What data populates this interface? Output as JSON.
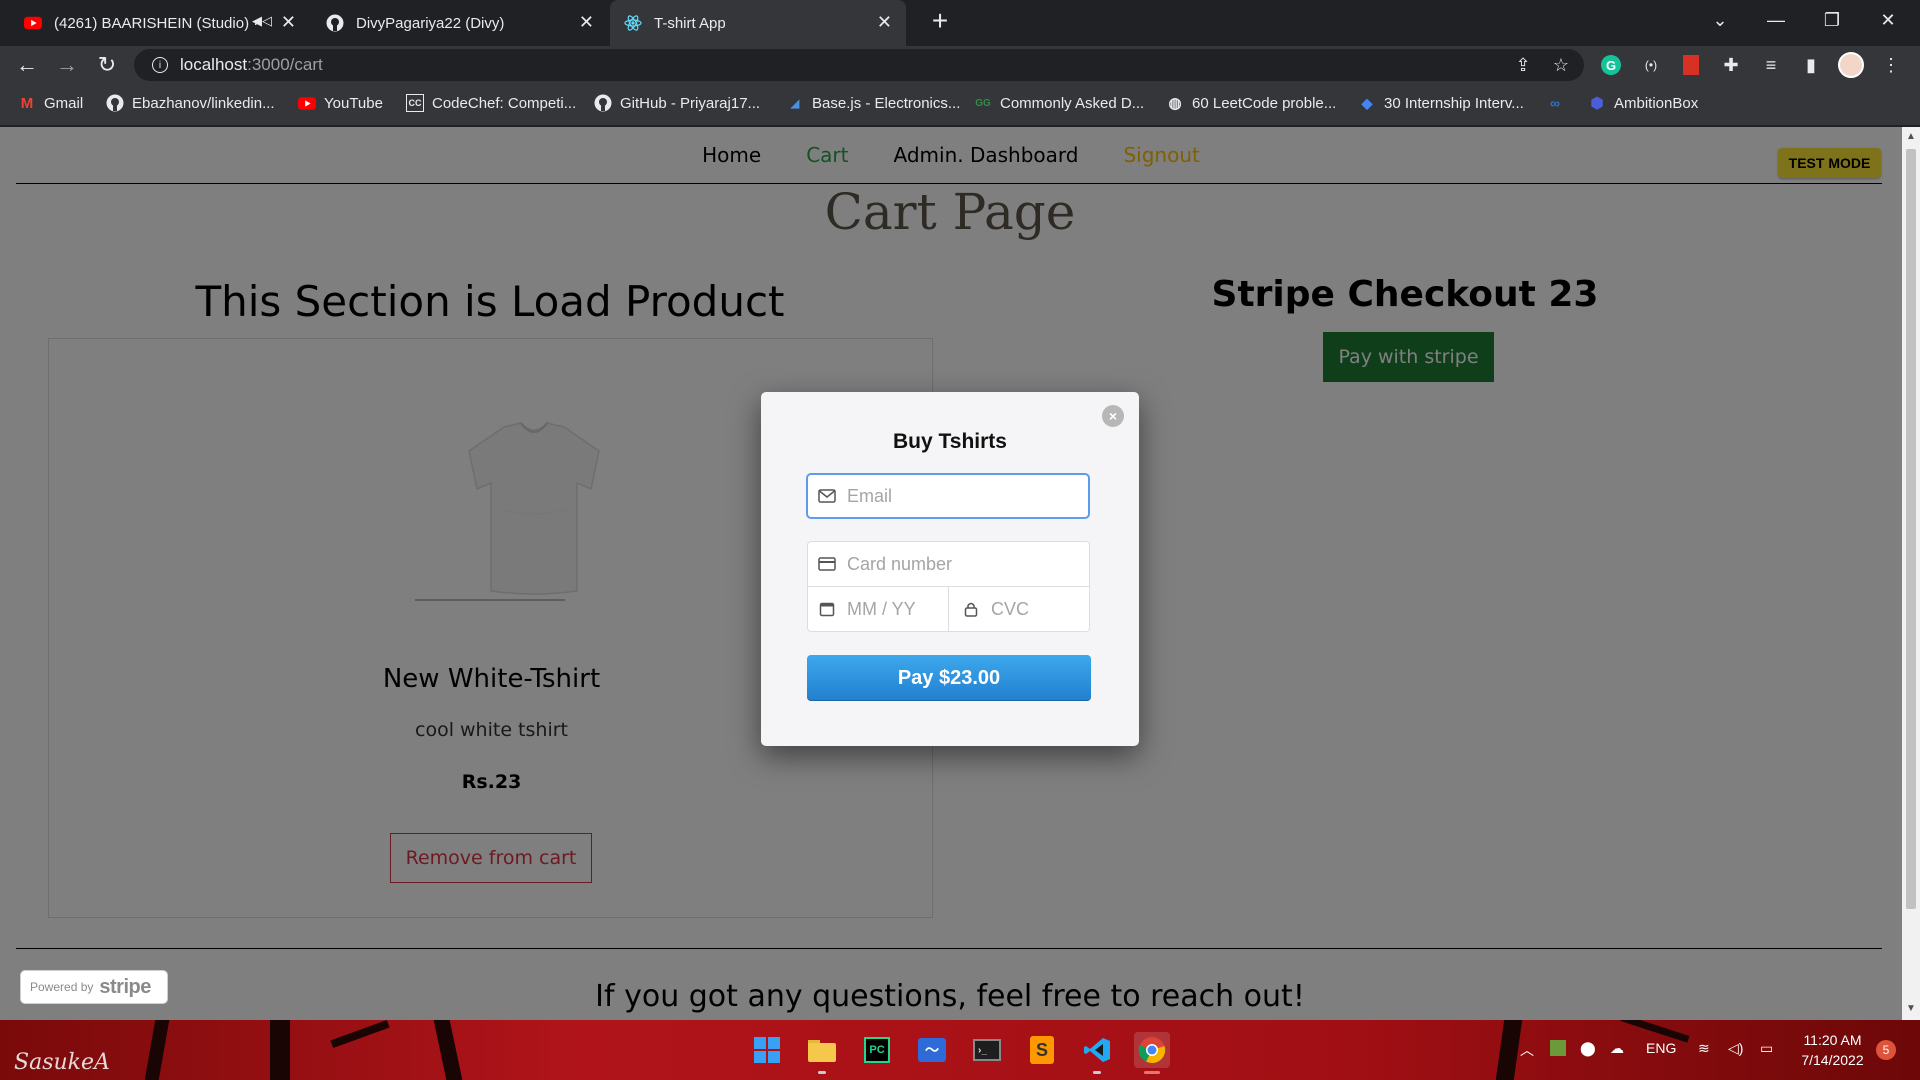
{
  "browser": {
    "tabs": [
      {
        "title": "(4261) BAARISHEIN (Studio) ·",
        "icon": "youtube-icon"
      },
      {
        "title": "DivyPagariya22 (Divy)",
        "icon": "github-icon"
      },
      {
        "title": "T-shirt App",
        "icon": "react-icon",
        "active": true
      }
    ],
    "close_glyph": "✕",
    "new_tab_glyph": "+",
    "url_host": "localhost",
    "url_path": ":3000/cart",
    "bookmarks": [
      {
        "label": "Gmail",
        "icon": "gmail-icon"
      },
      {
        "label": "Ebazhanov/linkedin...",
        "icon": "github-icon"
      },
      {
        "label": "YouTube",
        "icon": "youtube-icon"
      },
      {
        "label": "CodeChef: Competi...",
        "icon": "codechef-icon"
      },
      {
        "label": "GitHub - Priyaraj17...",
        "icon": "github-icon"
      },
      {
        "label": "Base.js - Electronics...",
        "icon": "basejs-icon"
      },
      {
        "label": "Commonly Asked D...",
        "icon": "gfg-icon"
      },
      {
        "label": "60 LeetCode proble...",
        "icon": "globe-icon"
      },
      {
        "label": "30 Internship Interv...",
        "icon": "bookmark-icon"
      },
      {
        "label": "",
        "icon": "coursera-icon"
      },
      {
        "label": "AmbitionBox",
        "icon": "ambitionbox-icon"
      }
    ]
  },
  "site": {
    "nav": {
      "home": "Home",
      "cart": "Cart",
      "admin": "Admin. Dashboard",
      "signout": "Signout"
    },
    "test_mode": "TEST MODE",
    "page_title": "Cart Page",
    "left_heading": "This Section is Load Product",
    "product": {
      "name": "New White-Tshirt",
      "description": "cool white tshirt",
      "price": "Rs.23",
      "remove_label": "Remove from cart"
    },
    "right_heading": "Stripe Checkout 23",
    "pay_with_stripe": "Pay with stripe",
    "footer_text": "If you got any questions, feel free to reach out!",
    "powered_by": "Powered by",
    "powered_brand": "stripe"
  },
  "modal": {
    "title": "Buy Tshirts",
    "email_placeholder": "Email",
    "card_number_placeholder": "Card number",
    "expiry_placeholder": "MM / YY",
    "cvc_placeholder": "CVC",
    "pay_label": "Pay $23.00",
    "close_glyph": "×"
  },
  "taskbar": {
    "signature": "SasukeA",
    "language": "ENG",
    "time": "11:20 AM",
    "date": "7/14/2022",
    "notification_count": "5"
  },
  "colors": {
    "accent_green": "#28a745",
    "signout_yellow": "#ffc107",
    "remove_red": "#dc3545",
    "stripe_blue": "#2b8fdb",
    "test_mode_yellow": "#fde534"
  }
}
